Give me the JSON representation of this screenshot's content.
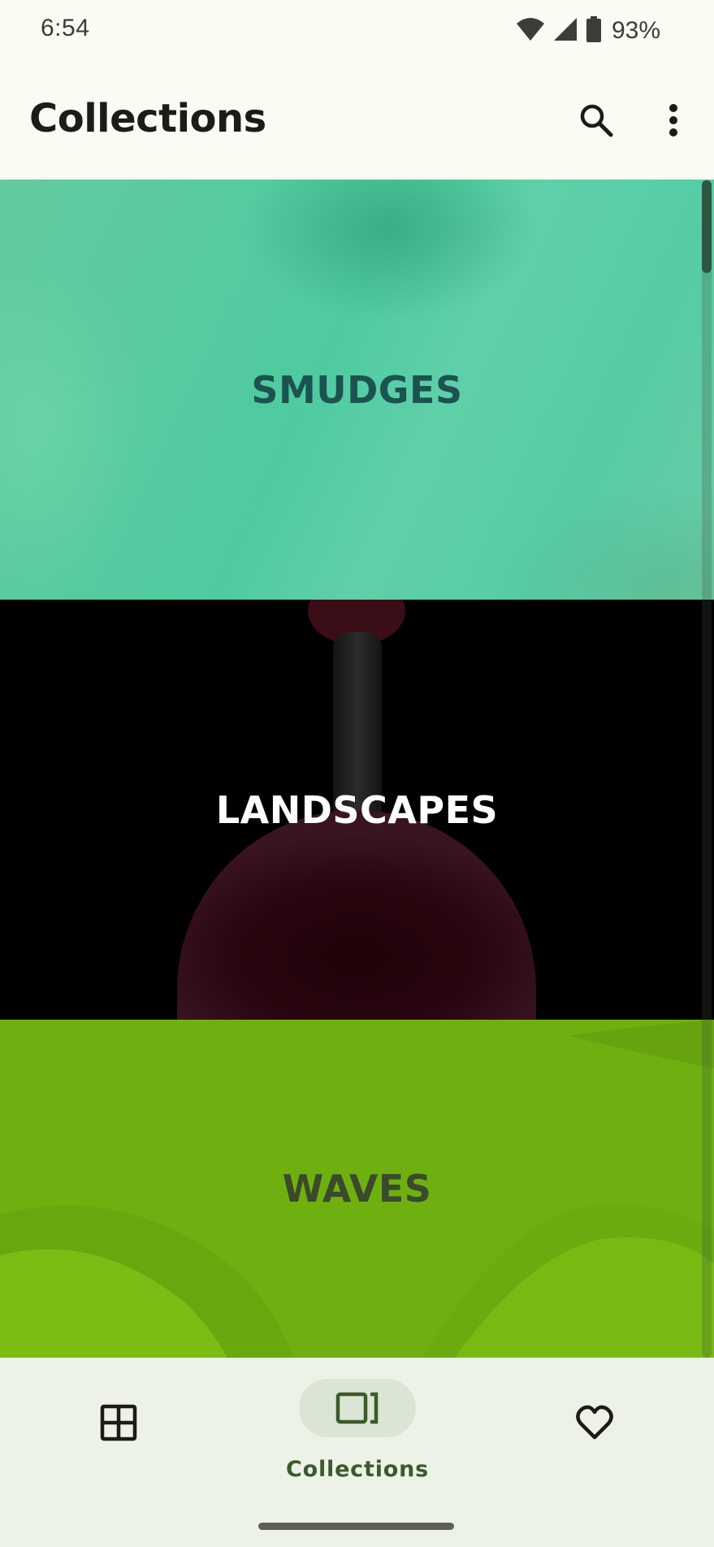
{
  "status_bar": {
    "time": "6:54",
    "battery_percent": "93%",
    "icons": [
      "wifi-icon",
      "signal-icon",
      "battery-icon"
    ]
  },
  "app_bar": {
    "title": "Collections",
    "actions": [
      "search-icon",
      "more-vert-icon"
    ]
  },
  "collections": [
    {
      "label": "SMUDGES",
      "label_color": "#1c5350"
    },
    {
      "label": "LANDSCAPES",
      "label_color": "#ffffff"
    },
    {
      "label": "WAVES",
      "label_color": "#3b4a2b"
    }
  ],
  "bottom_nav": {
    "items": [
      {
        "icon": "grid-icon",
        "label": "",
        "selected": false
      },
      {
        "icon": "collections-icon",
        "label": "Collections",
        "selected": true
      },
      {
        "icon": "heart-icon",
        "label": "",
        "selected": false
      }
    ]
  },
  "colors": {
    "background": "#f8fcf3",
    "nav_background": "#ecf2e6",
    "nav_indicator": "#dbe5d4",
    "accent": "#3b5a2d"
  }
}
